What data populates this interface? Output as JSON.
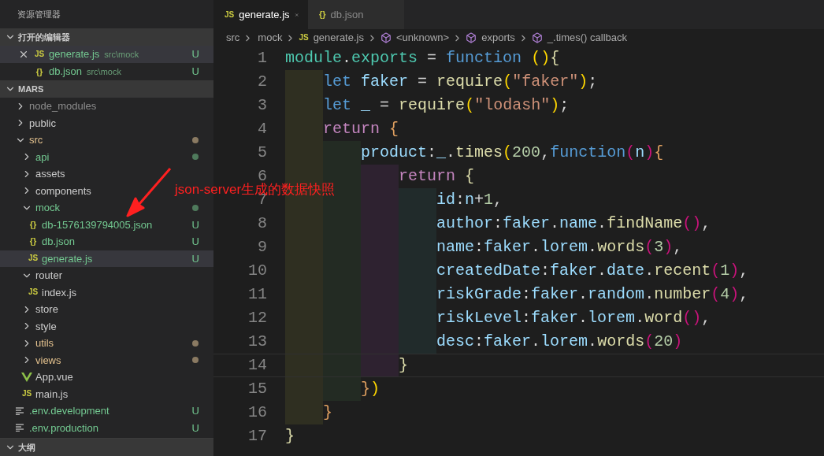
{
  "sidebar": {
    "title": "资源管理器",
    "open_editors": {
      "title": "打开的编辑器",
      "expanded": true,
      "items": [
        {
          "name": "generate.js",
          "path": "src\\mock",
          "icon_text": "JS",
          "kind": "js",
          "badge": "U",
          "untracked": true,
          "selected": true
        },
        {
          "name": "db.json",
          "path": "src\\mock",
          "icon_text": "{}",
          "kind": "json",
          "badge": "U",
          "untracked": true,
          "selected": false
        }
      ]
    },
    "project": {
      "title": "MARS",
      "expanded": true,
      "items": [
        {
          "name": "node_modules",
          "kind": "folder",
          "expanded": false,
          "ignored": true,
          "selected": false
        },
        {
          "name": "public",
          "kind": "folder",
          "expanded": false,
          "selected": false
        },
        {
          "name": "src",
          "kind": "folder",
          "expanded": true,
          "modified": true,
          "color": "#8a7a62",
          "selected": false,
          "children": [
            {
              "name": "api",
              "kind": "folder",
              "expanded": false,
              "untracked": true,
              "color": "#4f7a5c",
              "selected": false
            },
            {
              "name": "assets",
              "kind": "folder",
              "expanded": false,
              "selected": false
            },
            {
              "name": "components",
              "kind": "folder",
              "expanded": false,
              "selected": false
            },
            {
              "name": "mock",
              "kind": "folder",
              "expanded": true,
              "untracked": true,
              "color": "#4f7a5c",
              "selected": false,
              "children": [
                {
                  "name": "db-1576139794005.json",
                  "kind": "json",
                  "icon_text": "{}",
                  "untracked": true,
                  "badge": "U",
                  "selected": false
                },
                {
                  "name": "db.json",
                  "kind": "json",
                  "icon_text": "{}",
                  "untracked": true,
                  "badge": "U",
                  "selected": false
                },
                {
                  "name": "generate.js",
                  "kind": "js",
                  "icon_text": "JS",
                  "untracked": true,
                  "badge": "U",
                  "selected": true
                }
              ]
            },
            {
              "name": "router",
              "kind": "folder",
              "expanded": true,
              "selected": false,
              "children": [
                {
                  "name": "index.js",
                  "kind": "js",
                  "icon_text": "JS",
                  "selected": false
                }
              ]
            },
            {
              "name": "store",
              "kind": "folder",
              "expanded": false,
              "selected": false
            },
            {
              "name": "style",
              "kind": "folder",
              "expanded": false,
              "selected": false
            },
            {
              "name": "utils",
              "kind": "folder",
              "expanded": false,
              "modified": true,
              "color": "#8a7a62",
              "selected": false
            },
            {
              "name": "views",
              "kind": "folder",
              "expanded": false,
              "modified": true,
              "color": "#8a7a62",
              "selected": false
            },
            {
              "name": "App.vue",
              "kind": "vue",
              "selected": false
            },
            {
              "name": "main.js",
              "kind": "js",
              "icon_text": "JS",
              "selected": false
            }
          ]
        },
        {
          "name": ".env.development",
          "kind": "env",
          "untracked": true,
          "badge": "U",
          "selected": false
        },
        {
          "name": ".env.production",
          "kind": "env",
          "untracked": true,
          "badge": "U",
          "selected": false
        }
      ]
    },
    "outline": {
      "title": "大纲",
      "expanded": true
    }
  },
  "tabs": [
    {
      "label": "generate.js",
      "icon_text": "JS",
      "kind": "js",
      "selected": true
    },
    {
      "label": "db.json",
      "icon_text": "{}",
      "kind": "json",
      "selected": false
    }
  ],
  "breadcrumb": [
    {
      "label": "src",
      "kind": "plain"
    },
    {
      "label": "mock",
      "kind": "plain"
    },
    {
      "label": "generate.js",
      "kind": "js",
      "icon_text": "JS"
    },
    {
      "label": "<unknown>",
      "kind": "symbol"
    },
    {
      "label": "exports",
      "kind": "symbol"
    },
    {
      "label": "_.times() callback",
      "kind": "symbol"
    }
  ],
  "code": [
    {
      "number": "1",
      "current": false,
      "text": "module.exports = function (){"
    },
    {
      "number": "2",
      "current": false,
      "text": "    let faker = require(\"faker\");"
    },
    {
      "number": "3",
      "current": false,
      "text": "    let _ = require(\"lodash\");"
    },
    {
      "number": "4",
      "current": false,
      "text": "    return {"
    },
    {
      "number": "5",
      "current": false,
      "text": "        product:_.times(200,function(n){"
    },
    {
      "number": "6",
      "current": false,
      "text": "            return {"
    },
    {
      "number": "7",
      "current": false,
      "text": "                id:n+1,"
    },
    {
      "number": "8",
      "current": false,
      "text": "                author:faker.name.findName(),"
    },
    {
      "number": "9",
      "current": false,
      "text": "                name:faker.lorem.words(3),"
    },
    {
      "number": "10",
      "current": false,
      "text": "                createdDate:faker.date.recent(1),"
    },
    {
      "number": "11",
      "current": false,
      "text": "                riskGrade:faker.random.number(4),"
    },
    {
      "number": "12",
      "current": false,
      "text": "                riskLevel:faker.lorem.word(),"
    },
    {
      "number": "13",
      "current": false,
      "text": "                desc:faker.lorem.words(20)"
    },
    {
      "number": "14",
      "current": true,
      "text": "            }"
    },
    {
      "number": "15",
      "current": false,
      "text": "        })"
    },
    {
      "number": "16",
      "current": false,
      "text": "    }"
    },
    {
      "number": "17",
      "current": false,
      "text": "}"
    }
  ],
  "annotation": {
    "text": "json-server生成的数据快照"
  }
}
